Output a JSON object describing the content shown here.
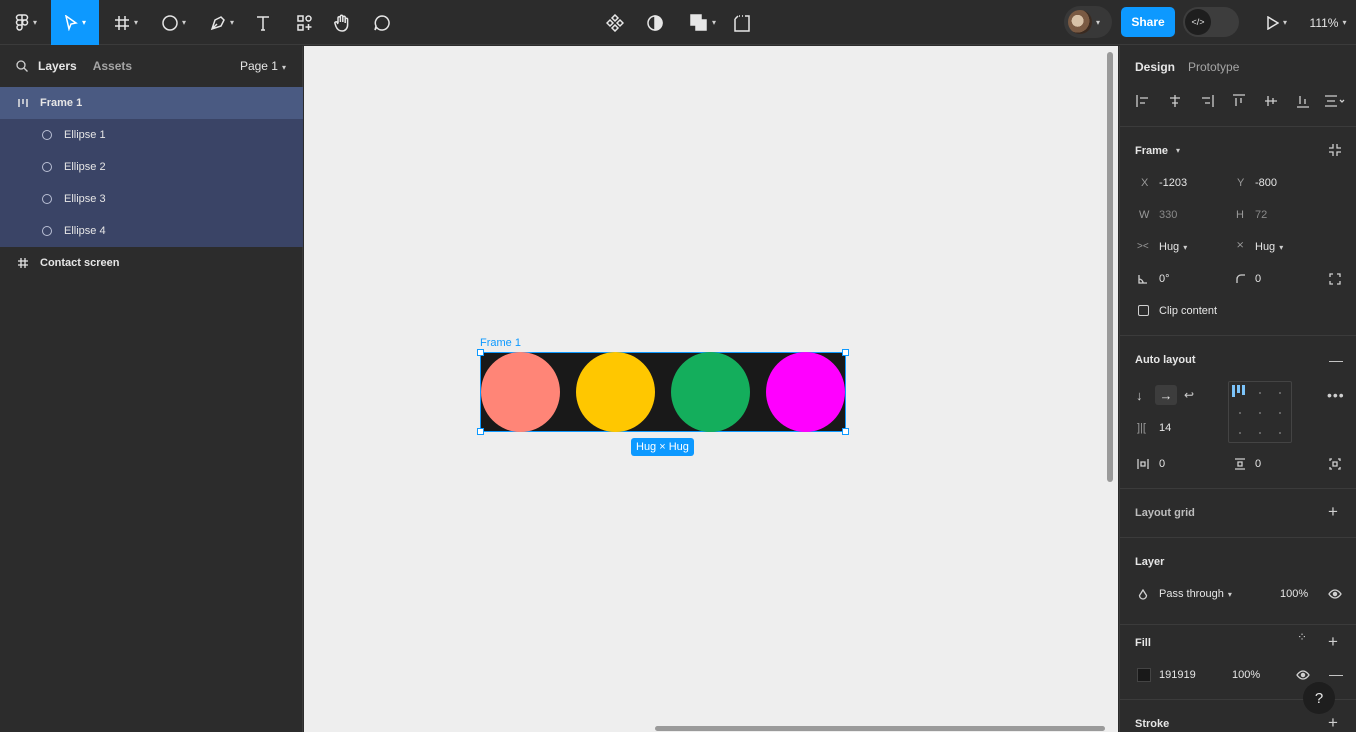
{
  "toolbar": {
    "share_label": "Share",
    "zoom": "111%",
    "devmode_glyph": "</>"
  },
  "left_panel": {
    "tabs": [
      "Layers",
      "Assets"
    ],
    "page_selector": "Page 1",
    "layers": [
      {
        "label": "Frame 1",
        "icon": "autolayout-icon"
      },
      {
        "label": "Ellipse 1",
        "icon": "ellipse-icon"
      },
      {
        "label": "Ellipse 2",
        "icon": "ellipse-icon"
      },
      {
        "label": "Ellipse 3",
        "icon": "ellipse-icon"
      },
      {
        "label": "Ellipse 4",
        "icon": "ellipse-icon"
      },
      {
        "label": "Contact screen",
        "icon": "frame-icon"
      }
    ]
  },
  "canvas": {
    "frame_label": "Frame 1",
    "size_badge": "Hug × Hug",
    "frame_color": "#191919",
    "ellipse_colors": [
      "#ff8577",
      "#ffc700",
      "#14ae5c",
      "#ff00ff"
    ]
  },
  "right_panel": {
    "tabs": [
      "Design",
      "Prototype"
    ],
    "frame_section": "Frame",
    "x_label": "X",
    "x_value": "-1203",
    "y_label": "Y",
    "y_value": "-800",
    "w_label": "W",
    "w_value": "330",
    "h_label": "H",
    "h_value": "72",
    "width_mode": "Hug",
    "height_mode": "Hug",
    "rotation": "0°",
    "corner_radius": "0",
    "clip_content": "Clip content",
    "auto_layout": "Auto layout",
    "gap": "14",
    "padding_h": "0",
    "padding_v": "0",
    "layout_grid": "Layout grid",
    "layer_section": "Layer",
    "blend_mode": "Pass through",
    "layer_opacity": "100%",
    "fill_section": "Fill",
    "fill_hex": "191919",
    "fill_opacity": "100%",
    "stroke_section": "Stroke"
  },
  "help_label": "?"
}
